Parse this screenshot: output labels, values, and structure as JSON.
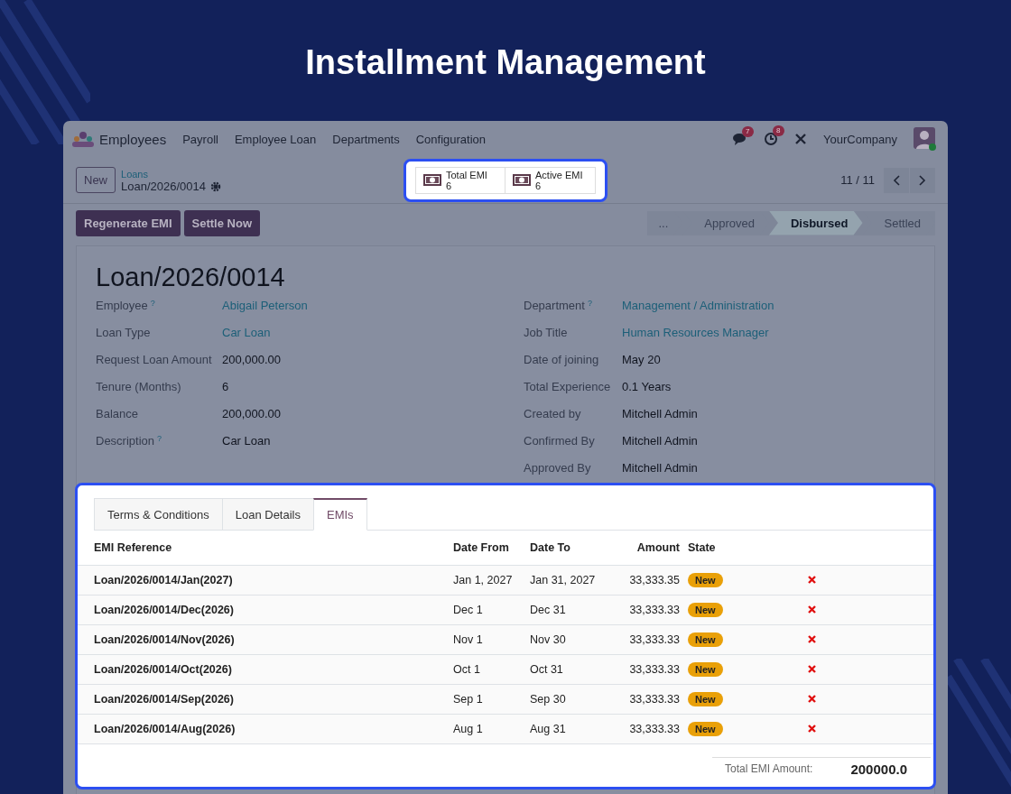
{
  "title": "Installment Management",
  "navbar": {
    "app": "Employees",
    "menus": [
      "Payroll",
      "Employee Loan",
      "Departments",
      "Configuration"
    ],
    "message_count": "7",
    "activity_count": "8",
    "company": "YourCompany"
  },
  "control_panel": {
    "new_button": "New",
    "breadcrumb": "Loans",
    "record": "Loan/2026/0014",
    "pager": "11 / 11",
    "smart_buttons": [
      {
        "label": "Total EMI",
        "value": "6"
      },
      {
        "label": "Active EMI",
        "value": "6"
      }
    ]
  },
  "actions": [
    "Regenerate EMI",
    "Settle Now"
  ],
  "statusbar": [
    {
      "label": "...",
      "selected": false
    },
    {
      "label": "Approved",
      "selected": false
    },
    {
      "label": "Disbursed",
      "selected": true
    },
    {
      "label": "Settled",
      "selected": false
    }
  ],
  "sheet": {
    "title": "Loan/2026/0014",
    "left_fields": [
      {
        "label": "Employee",
        "help": "?",
        "value": "Abigail Peterson",
        "link": true
      },
      {
        "label": "Loan Type",
        "value": "Car Loan",
        "link": true
      },
      {
        "label": "Request Loan Amount",
        "value": "200,000.00",
        "link": false
      },
      {
        "label": "Tenure (Months)",
        "value": "6",
        "link": false
      },
      {
        "label": "Balance",
        "value": "200,000.00",
        "link": false
      },
      {
        "label": "Description",
        "help": "?",
        "value": "Car Loan",
        "link": false
      }
    ],
    "right_fields": [
      {
        "label": "Department",
        "help": "?",
        "value": "Management / Administration",
        "link": true
      },
      {
        "label": "Job Title",
        "value": "Human Resources Manager",
        "link": true
      },
      {
        "label": "Date of joining",
        "value": "May 20",
        "link": false
      },
      {
        "label": "Total Experience",
        "value": "0.1 Years",
        "link": false
      },
      {
        "label": "Created by",
        "value": "Mitchell Admin",
        "link": false
      },
      {
        "label": "Confirmed By",
        "value": "Mitchell Admin",
        "link": false
      },
      {
        "label": "Approved By",
        "value": "Mitchell Admin",
        "link": false
      }
    ]
  },
  "tabs": [
    {
      "label": "Terms & Conditions",
      "selected": false
    },
    {
      "label": "Loan Details",
      "selected": false
    },
    {
      "label": "EMIs",
      "selected": true
    }
  ],
  "table": {
    "columns": [
      "EMI Reference",
      "Date From",
      "Date To",
      "Amount",
      "State"
    ],
    "rows": [
      {
        "reference": "Loan/2026/0014/Jan(2027)",
        "date_from": "Jan 1, 2027",
        "date_to": "Jan 31, 2027",
        "amount": "33,333.35",
        "state": "New"
      },
      {
        "reference": "Loan/2026/0014/Dec(2026)",
        "date_from": "Dec 1",
        "date_to": "Dec 31",
        "amount": "33,333.33",
        "state": "New"
      },
      {
        "reference": "Loan/2026/0014/Nov(2026)",
        "date_from": "Nov 1",
        "date_to": "Nov 30",
        "amount": "33,333.33",
        "state": "New"
      },
      {
        "reference": "Loan/2026/0014/Oct(2026)",
        "date_from": "Oct 1",
        "date_to": "Oct 31",
        "amount": "33,333.33",
        "state": "New"
      },
      {
        "reference": "Loan/2026/0014/Sep(2026)",
        "date_from": "Sep 1",
        "date_to": "Sep 30",
        "amount": "33,333.33",
        "state": "New"
      },
      {
        "reference": "Loan/2026/0014/Aug(2026)",
        "date_from": "Aug 1",
        "date_to": "Aug 31",
        "amount": "33,333.33",
        "state": "New"
      }
    ],
    "total_label": "Total EMI Amount:",
    "total_value": "200000.0"
  }
}
